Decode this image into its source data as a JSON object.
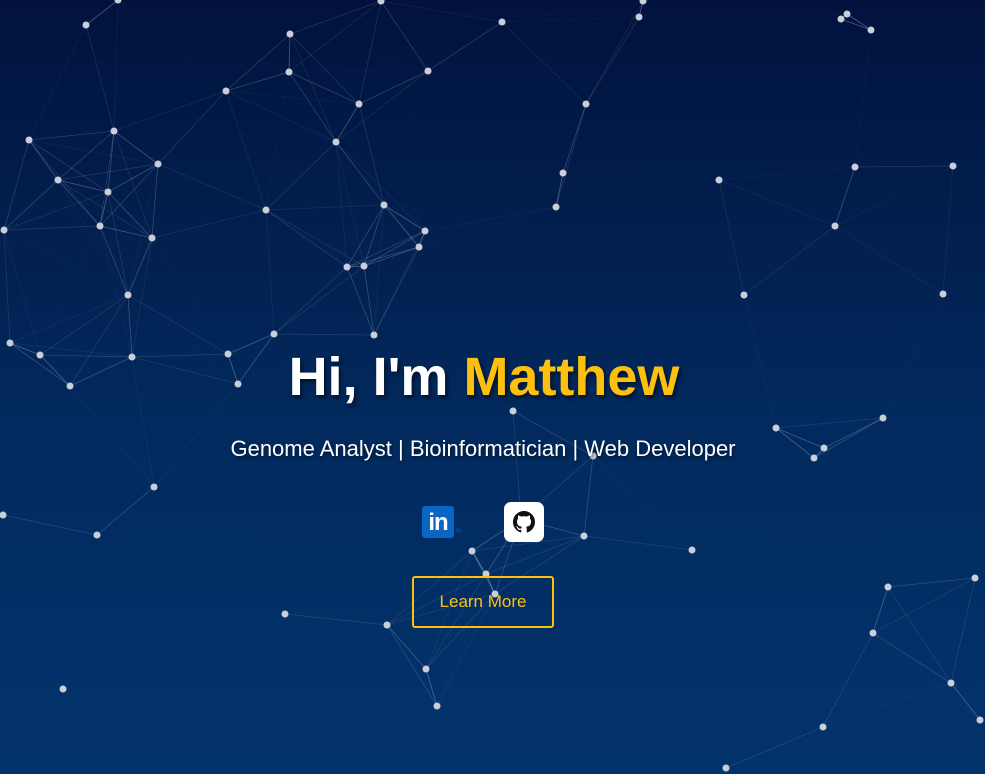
{
  "hero": {
    "greeting": "Hi, I'm ",
    "name": "Matthew",
    "subtitle": "Genome Analyst | Bioinformatician | Web Developer"
  },
  "social": {
    "linkedin_label": "in",
    "github_label": "GitHub"
  },
  "cta": {
    "learn_more_label": "Learn More"
  },
  "colors": {
    "accent": "#fdc00f",
    "background_top": "#01123d",
    "background_bottom": "#03336c",
    "linkedin_blue": "#0a66c2"
  },
  "icons": [
    "linkedin-icon",
    "github-icon"
  ]
}
